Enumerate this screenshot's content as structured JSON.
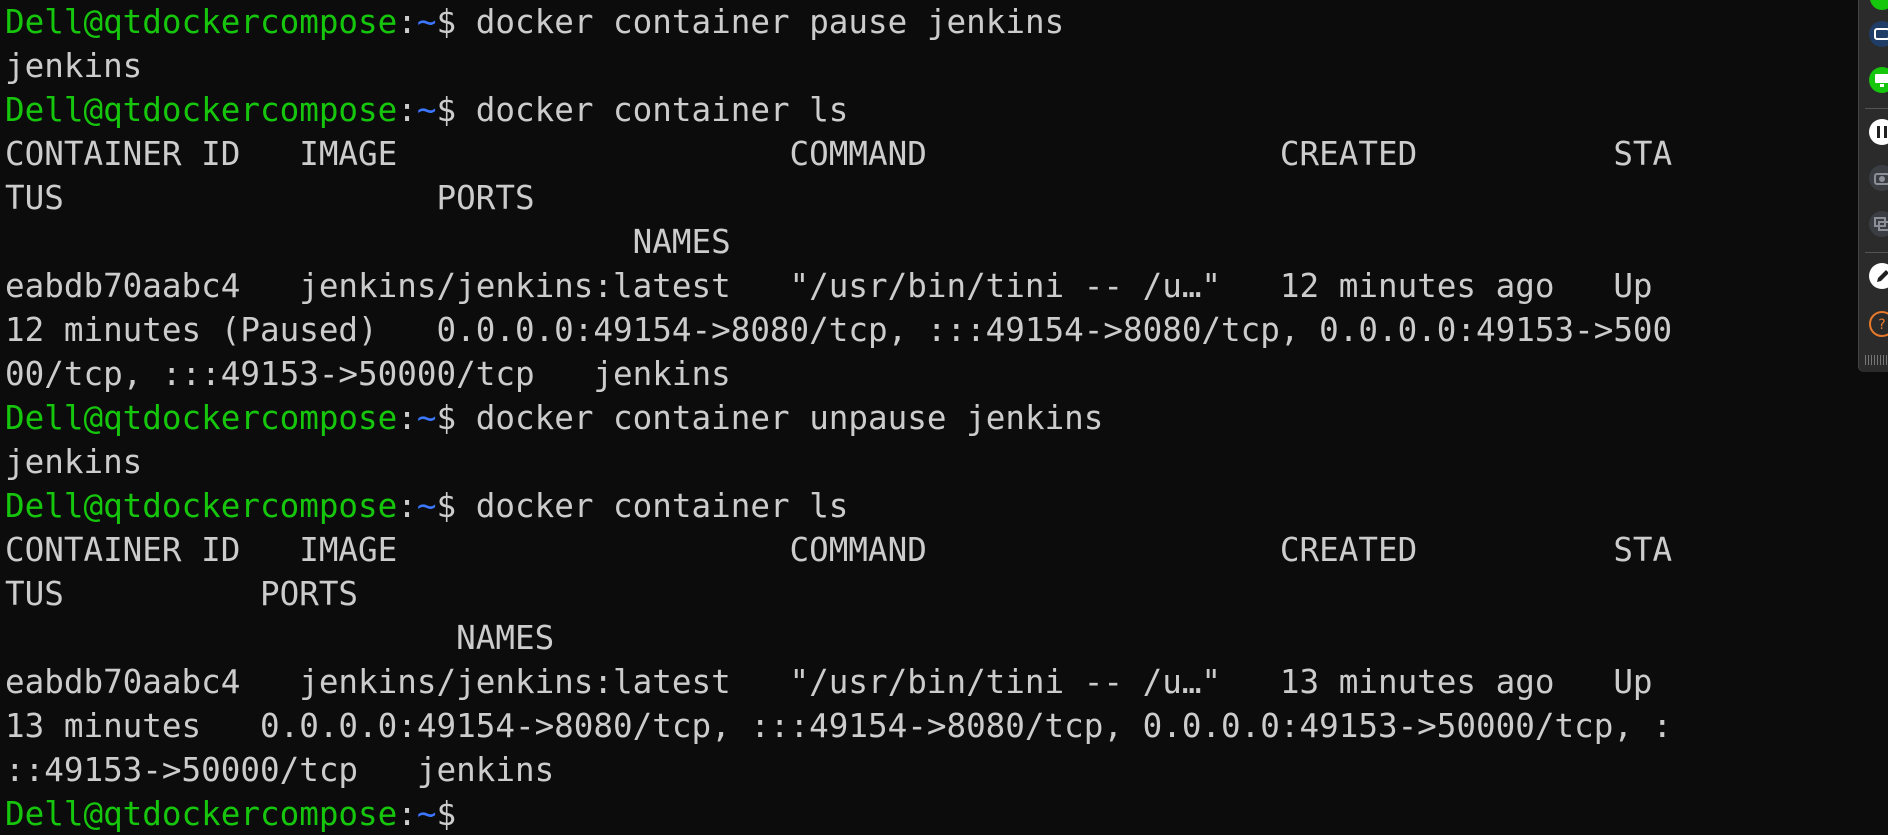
{
  "terminal": {
    "prompt": {
      "user_host": "Dell@qtdockercompose",
      "separator": ":",
      "path": "~",
      "symbol": "$ "
    },
    "lines": [
      {
        "type": "prompt",
        "cmd": "docker container pause jenkins"
      },
      {
        "type": "output",
        "text": "jenkins"
      },
      {
        "type": "prompt",
        "cmd": "docker container ls"
      },
      {
        "type": "output",
        "text": "CONTAINER ID   IMAGE                    COMMAND                  CREATED          STA"
      },
      {
        "type": "output",
        "text": "TUS                   PORTS"
      },
      {
        "type": "output",
        "text": "                                NAMES"
      },
      {
        "type": "output",
        "text": "eabdb70aabc4   jenkins/jenkins:latest   \"/usr/bin/tini -- /u…\"   12 minutes ago   Up"
      },
      {
        "type": "output",
        "text": "12 minutes (Paused)   0.0.0.0:49154->8080/tcp, :::49154->8080/tcp, 0.0.0.0:49153->500"
      },
      {
        "type": "output",
        "text": "00/tcp, :::49153->50000/tcp   jenkins"
      },
      {
        "type": "prompt",
        "cmd": "docker container unpause jenkins"
      },
      {
        "type": "output",
        "text": "jenkins"
      },
      {
        "type": "prompt",
        "cmd": "docker container ls"
      },
      {
        "type": "output",
        "text": "CONTAINER ID   IMAGE                    COMMAND                  CREATED          STA"
      },
      {
        "type": "output",
        "text": "TUS          PORTS"
      },
      {
        "type": "output",
        "text": "                       NAMES"
      },
      {
        "type": "output",
        "text": "eabdb70aabc4   jenkins/jenkins:latest   \"/usr/bin/tini -- /u…\"   13 minutes ago   Up"
      },
      {
        "type": "output",
        "text": "13 minutes   0.0.0.0:49154->8080/tcp, :::49154->8080/tcp, 0.0.0.0:49153->50000/tcp, :"
      },
      {
        "type": "output",
        "text": "::49153->50000/tcp   jenkins"
      },
      {
        "type": "prompt",
        "cmd": ""
      }
    ]
  },
  "side_toolbar": {
    "items": [
      {
        "icon": "notification-dot-icon",
        "color": "#16c60c"
      },
      {
        "icon": "window-icon",
        "color": "#2b6fd6"
      },
      {
        "icon": "screen-share-icon",
        "color": "#16c60c"
      },
      {
        "icon": "pause-icon",
        "color": "#ffffff"
      },
      {
        "icon": "camera-icon",
        "color": "#8a8f98"
      },
      {
        "icon": "copy-screens-icon",
        "color": "#8a8f98"
      },
      {
        "icon": "pen-icon",
        "color": "#ffffff"
      },
      {
        "icon": "help-icon",
        "color": "#e8792b"
      }
    ]
  }
}
